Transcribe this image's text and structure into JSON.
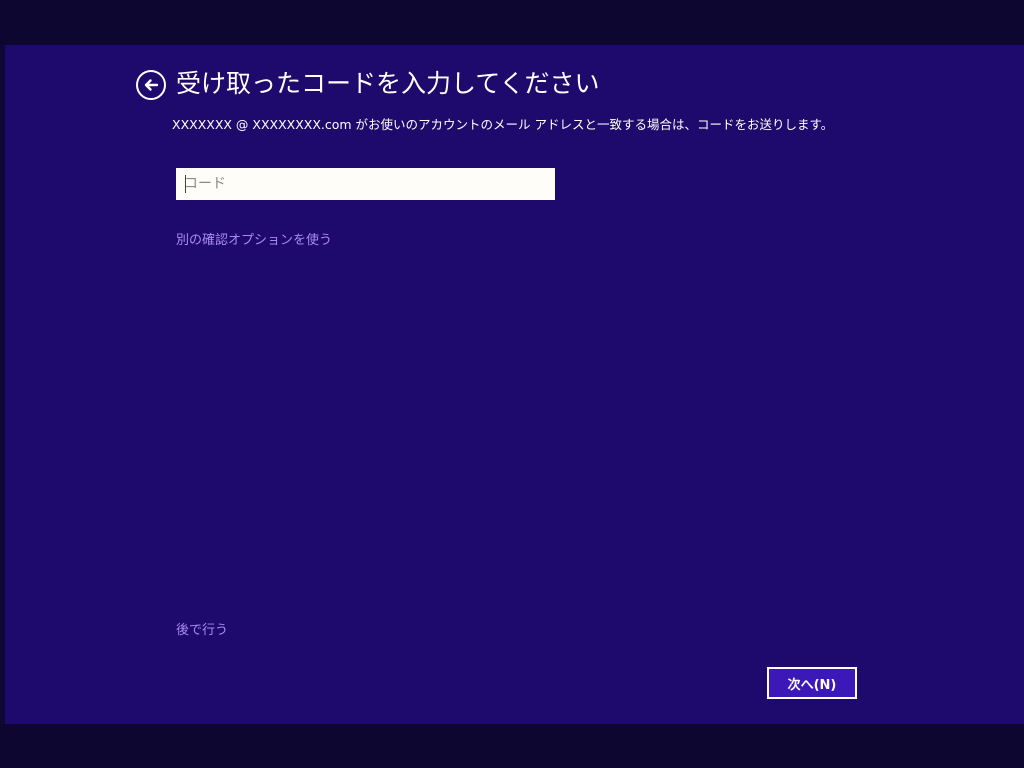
{
  "header": {
    "title": "受け取ったコードを入力してください",
    "back_icon": "back-arrow-icon"
  },
  "description": "XXXXXXX @ XXXXXXXX.com がお使いのアカウントのメール アドレスと一致する場合は、コードをお送りします。",
  "code_input": {
    "value": "",
    "placeholder": "コード"
  },
  "links": {
    "alternate_option": "別の確認オプションを使う",
    "later": "後で行う"
  },
  "buttons": {
    "next": "次へ(N)"
  },
  "colors": {
    "panel_background": "#1d0a6c",
    "outer_background": "#0c0630",
    "link": "#a98cf0",
    "button_fill": "#3d18b8"
  }
}
